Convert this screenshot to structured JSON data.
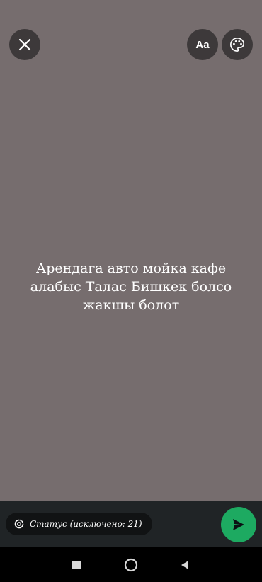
{
  "status_text": "Арендага авто мойка кафе алабыс Талас Бишкек болсо жакшы болот",
  "toolbar": {
    "close_icon": "close-icon",
    "font_button_label": "Aa",
    "palette_icon": "palette-icon"
  },
  "audience": {
    "icon": "status-ring-icon",
    "label": "Статус (исключено: 21)"
  },
  "send": {
    "icon": "send-icon"
  },
  "navigation": {
    "recents_icon": "square-recents-icon",
    "home_icon": "circle-home-icon",
    "back_icon": "triangle-back-icon"
  },
  "colors": {
    "background": "#766d6e",
    "button_bg": "#3d393a",
    "bottom_bar": "#202426",
    "chip_bg": "#111314",
    "send_accent": "#1daa61"
  }
}
